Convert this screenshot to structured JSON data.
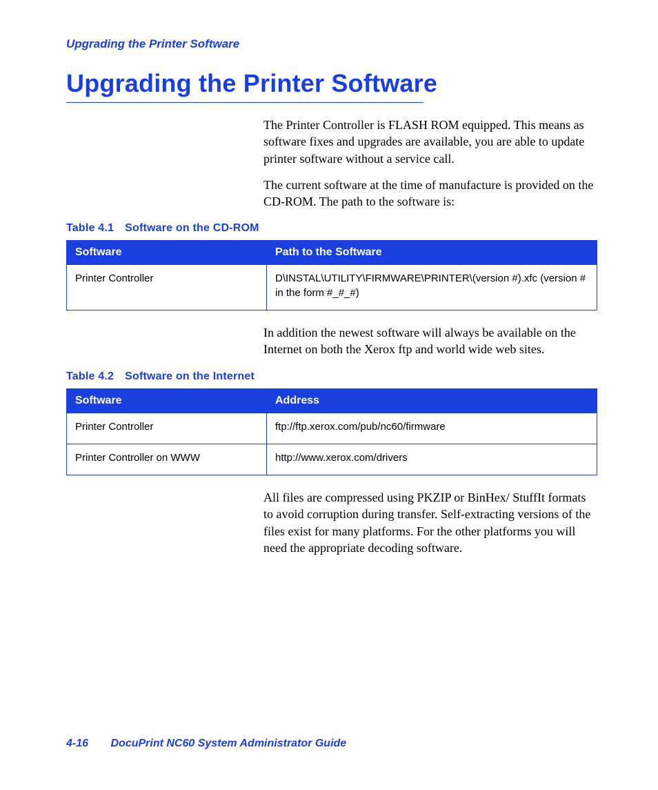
{
  "running_header": "Upgrading the Printer Software",
  "title": "Upgrading the Printer Software",
  "paragraphs": {
    "p1": "The Printer Controller is FLASH ROM equipped. This means as software fixes and upgrades are available, you are able to update printer software without a service call.",
    "p2": "The current software at the time of manufacture is provided on the CD-ROM. The path to the software is:",
    "p3": "In addition the newest software will always be available on the Internet on both the Xerox ftp and world wide web sites.",
    "p4": "All files are compressed using PKZIP or BinHex/ StuffIt formats to avoid corruption during transfer. Self-extracting versions of the files exist for many platforms. For the other platforms you will need the appropriate decoding software."
  },
  "table1": {
    "caption_number": "Table 4.1",
    "caption_title": "Software on the CD-ROM",
    "headers": {
      "c1": "Software",
      "c2": "Path to the Software"
    },
    "rows": [
      {
        "c1": "Printer Controller",
        "c2": "D\\INSTAL\\UTILITY\\FIRMWARE\\PRINTER\\(version #).xfc\n(version # in the form #_#_#)"
      }
    ]
  },
  "table2": {
    "caption_number": "Table 4.2",
    "caption_title": "Software on the Internet",
    "headers": {
      "c1": "Software",
      "c2": "Address"
    },
    "rows": [
      {
        "c1": "Printer Controller",
        "c2": "ftp://ftp.xerox.com/pub/nc60/firmware"
      },
      {
        "c1": "Printer Controller on WWW",
        "c2": "http://www.xerox.com/drivers"
      }
    ]
  },
  "footer": {
    "page_number": "4-16",
    "doc_title": "DocuPrint NC60 System Administrator Guide"
  }
}
